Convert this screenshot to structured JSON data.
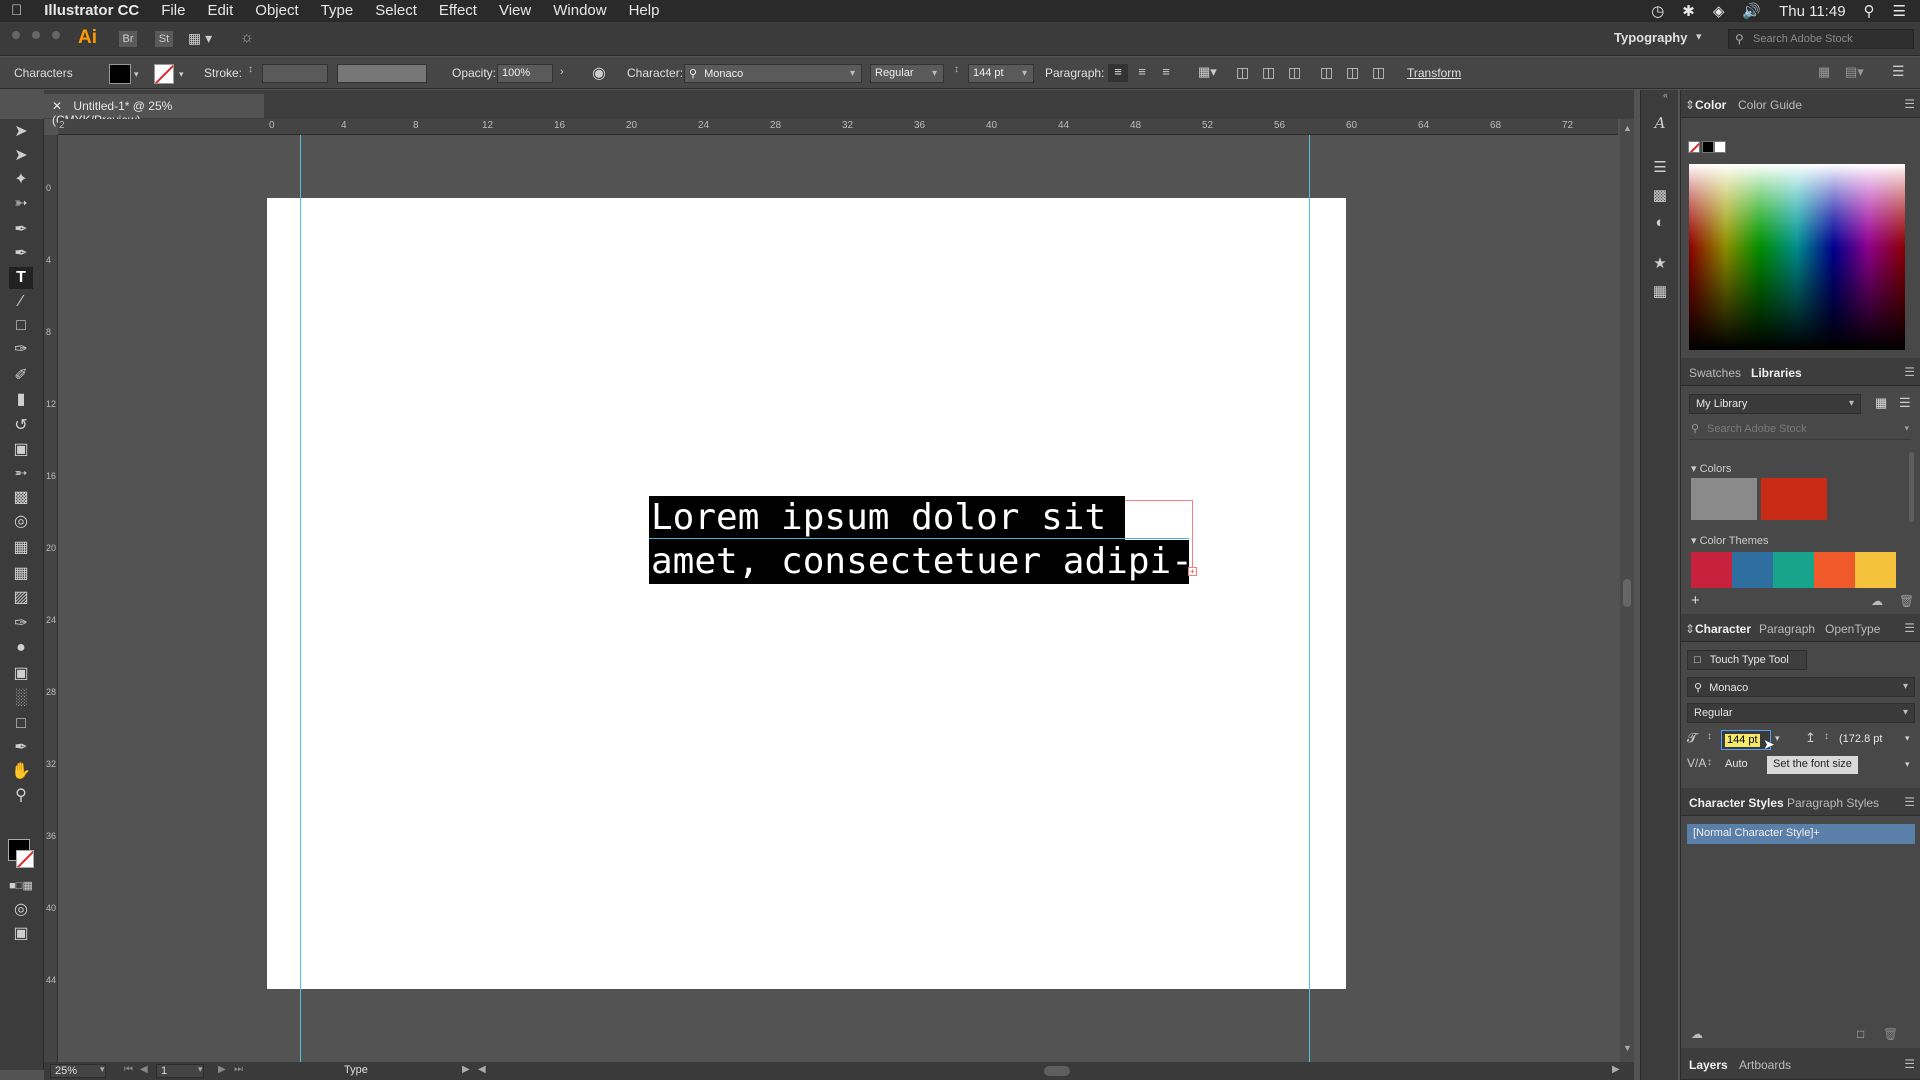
{
  "menubar": {
    "app_name": "Illustrator CC",
    "items": [
      "File",
      "Edit",
      "Object",
      "Type",
      "Select",
      "Effect",
      "View",
      "Window",
      "Help"
    ],
    "clock": "Thu 11:49"
  },
  "appbar": {
    "logo": "Ai",
    "bridge": "Br",
    "stock": "St",
    "workspace": "Typography",
    "search_placeholder": "Search Adobe Stock"
  },
  "controlbar": {
    "selection_label": "Characters",
    "stroke_label": "Stroke:",
    "opacity_label": "Opacity:",
    "opacity_value": "100%",
    "character_label": "Character:",
    "font": "Monaco",
    "style": "Regular",
    "size": "144 pt",
    "paragraph_label": "Paragraph:",
    "transform": "Transform"
  },
  "document": {
    "tab_title": "Untitled-1* @ 25% (CMYK/Preview)",
    "text_line1": "Lorem ipsum dolor sit",
    "text_line2": "amet, consectetuer adipi-"
  },
  "rulers": {
    "h_ticks": [
      "2",
      "0",
      "4",
      "8",
      "12",
      "16",
      "20",
      "24",
      "28",
      "32",
      "36",
      "40",
      "44",
      "48",
      "52",
      "56",
      "60",
      "64",
      "68",
      "72"
    ],
    "v_ticks": [
      "0",
      "4",
      "8",
      "12",
      "16",
      "20",
      "24",
      "28",
      "32",
      "36",
      "40",
      "44"
    ]
  },
  "statusbar": {
    "zoom": "25%",
    "artboard": "1",
    "tool": "Type"
  },
  "panels": {
    "color": {
      "tabs": [
        "Color",
        "Color Guide"
      ]
    },
    "libraries": {
      "tabs": [
        "Swatches",
        "Libraries"
      ],
      "library": "My Library",
      "search_placeholder": "Search Adobe Stock",
      "colors_label": "Colors",
      "themes_label": "Color Themes",
      "swatch_colors": [
        "#8a8a8a",
        "#c92a14"
      ],
      "theme_colors": [
        "#c8213d",
        "#2f6fa0",
        "#16a58c",
        "#f05a2a",
        "#f5c23c"
      ]
    },
    "character": {
      "tabs": [
        "Character",
        "Paragraph",
        "OpenType"
      ],
      "touch_type": "Touch Type Tool",
      "font": "Monaco",
      "style": "Regular",
      "size": "144 pt",
      "leading": "(172.8 pt",
      "kerning": "Auto",
      "tooltip": "Set the font size"
    },
    "styles": {
      "tabs": [
        "Character Styles",
        "Paragraph Styles"
      ],
      "item": "[Normal Character Style]+"
    },
    "layers": {
      "tabs": [
        "Layers",
        "Artboards"
      ]
    }
  }
}
